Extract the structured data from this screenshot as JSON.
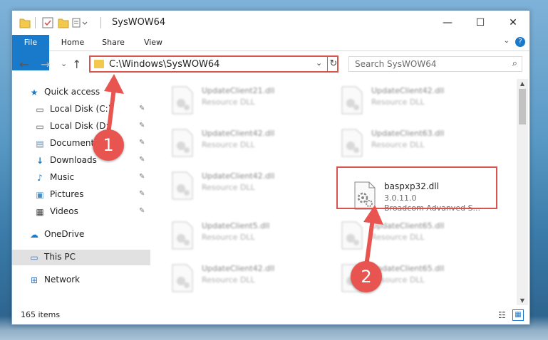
{
  "window": {
    "title": "SysWOW64",
    "minimize_glyph": "—",
    "maximize_glyph": "☐",
    "close_glyph": "✕"
  },
  "ribbon": {
    "tabs": [
      "File",
      "Home",
      "Share",
      "View"
    ],
    "help_glyph": "?",
    "expand_glyph": "⌄"
  },
  "nav": {
    "back_glyph": "←",
    "forward_glyph": "→",
    "recent_glyph": "⌄",
    "up_glyph": "↑",
    "address": "C:\\Windows\\SysWOW64",
    "address_dropdown_glyph": "⌄",
    "refresh_glyph": "↻",
    "search_placeholder": "Search SysWOW64",
    "search_glyph": "⌕"
  },
  "sidebar": {
    "items": [
      {
        "label": "Quick access",
        "icon": "star-icon",
        "glyph": "★",
        "color": "#1979ca"
      },
      {
        "label": "Local Disk (C:)",
        "icon": "drive-icon",
        "glyph": "▭",
        "color": "#555555",
        "pinned": true
      },
      {
        "label": "Local Disk (D:)",
        "icon": "drive-icon",
        "glyph": "▭",
        "color": "#555555",
        "pinned": true
      },
      {
        "label": "Documents",
        "icon": "documents-icon",
        "glyph": "▤",
        "color": "#6b8ca8",
        "pinned": true
      },
      {
        "label": "Downloads",
        "icon": "download-icon",
        "glyph": "↓",
        "color": "#1979ca",
        "pinned": true
      },
      {
        "label": "Music",
        "icon": "music-icon",
        "glyph": "♪",
        "color": "#1979ca",
        "pinned": true
      },
      {
        "label": "Pictures",
        "icon": "pictures-icon",
        "glyph": "▣",
        "color": "#4a90c8",
        "pinned": true
      },
      {
        "label": "Videos",
        "icon": "videos-icon",
        "glyph": "▦",
        "color": "#444444",
        "pinned": true
      },
      {
        "label": "OneDrive",
        "icon": "cloud-icon",
        "glyph": "☁",
        "color": "#1979ca"
      },
      {
        "label": "This PC",
        "icon": "monitor-icon",
        "glyph": "▭",
        "color": "#3a7bbf",
        "selected": true
      },
      {
        "label": "Network",
        "icon": "network-icon",
        "glyph": "⊞",
        "color": "#3a7bbf"
      }
    ],
    "pin_glyph": "✎"
  },
  "files": [
    {
      "name": "UpdateClient21.dll",
      "desc": "Resource DLL"
    },
    {
      "name": "UpdateClient42.dll",
      "desc": "Resource DLL"
    },
    {
      "name": "UpdateClient42.dll",
      "desc": "Resource DLL"
    },
    {
      "name": "UpdateClient63.dll",
      "desc": "Resource DLL"
    },
    {
      "name": "UpdateClient42.dll",
      "desc": "Resource DLL"
    },
    {
      "name": "baspxp32.dll",
      "desc": "3.0.11.0",
      "desc2": "Broadcom Advanved S...",
      "highlight": true
    },
    {
      "name": "UpdateClient5.dll",
      "desc": "Resource DLL"
    },
    {
      "name": "UpdateClient65.dll",
      "desc": "Resource DLL"
    },
    {
      "name": "UpdateClient42.dll",
      "desc": "Resource DLL"
    },
    {
      "name": "UpdateClient65.dll",
      "desc": "Resource DLL"
    }
  ],
  "status": {
    "count": "165 items",
    "details_view_glyph": "☷",
    "icons_view_glyph": "▦"
  },
  "callouts": [
    "1",
    "2"
  ],
  "colors": {
    "accent": "#1979ca",
    "annotation": "#e85550"
  }
}
